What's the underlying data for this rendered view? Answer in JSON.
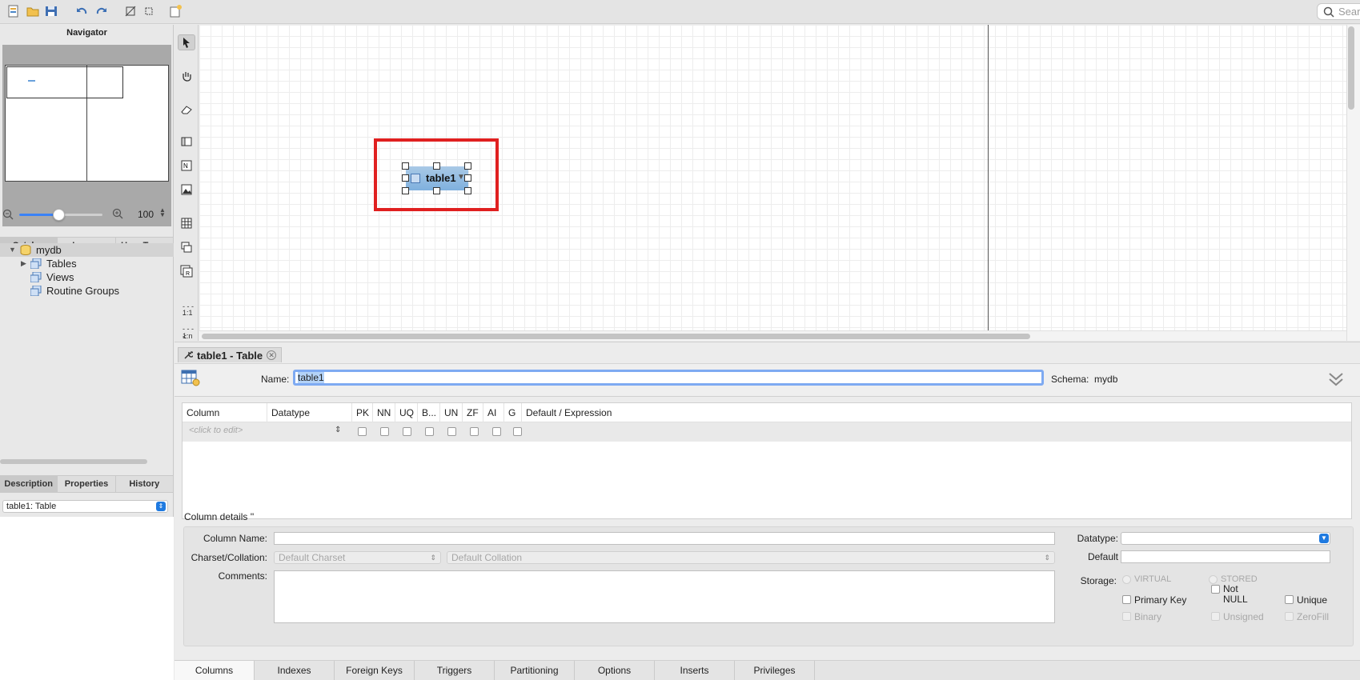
{
  "toolbar": {
    "icons": [
      "new-document-icon",
      "open-folder-icon",
      "save-icon",
      "undo-icon",
      "redo-icon",
      "toggle-grid-icon",
      "align-icon",
      "new-tab-icon"
    ],
    "search_placeholder": "Sear"
  },
  "navigator": {
    "title": "Navigator",
    "zoom_value": "100",
    "zoom_level": 0.47
  },
  "catalog_tabs": [
    "Catalog",
    "Layers",
    "User Types"
  ],
  "catalog_tree": {
    "schema": "mydb",
    "children": [
      "Tables",
      "Views",
      "Routine Groups"
    ]
  },
  "description_tabs": [
    "Description",
    "Properties",
    "History"
  ],
  "description_select": "table1: Table",
  "tools": {
    "rel_one_to_one": "1:1",
    "rel_one_to_many": "1:n"
  },
  "canvas": {
    "table_name": "table1"
  },
  "editor": {
    "tab_title": "table1 - Table",
    "name_label": "Name:",
    "name_value": "table1",
    "schema_label": "Schema:",
    "schema_value": "mydb",
    "columns_header": [
      "Column",
      "Datatype",
      "PK",
      "NN",
      "UQ",
      "B...",
      "UN",
      "ZF",
      "AI",
      "G",
      "Default / Expression"
    ],
    "new_row_placeholder": "<click to edit>",
    "details": {
      "title": "Column details ''",
      "column_name_label": "Column Name:",
      "charset_label": "Charset/Collation:",
      "charset_value": "Default Charset",
      "collation_value": "Default Collation",
      "comments_label": "Comments:",
      "datatype_label": "Datatype:",
      "default_label": "Default",
      "storage_label": "Storage:",
      "virtual_label": "VIRTUAL",
      "stored_label": "STORED",
      "primary_key_label": "Primary Key",
      "not_null_label_1": "Not",
      "not_null_label_2": "NULL",
      "unique_label": "Unique",
      "binary_label": "Binary",
      "unsigned_label": "Unsigned",
      "zerofill_label": "ZeroFill"
    },
    "bottom_tabs": [
      "Columns",
      "Indexes",
      "Foreign Keys",
      "Triggers",
      "Partitioning",
      "Options",
      "Inserts",
      "Privileges"
    ],
    "active_bottom_tab": "Columns"
  },
  "colors": {
    "accent": "#1f7ae0",
    "highlight": "#e02020",
    "table_fill": "#8fbbe2"
  }
}
